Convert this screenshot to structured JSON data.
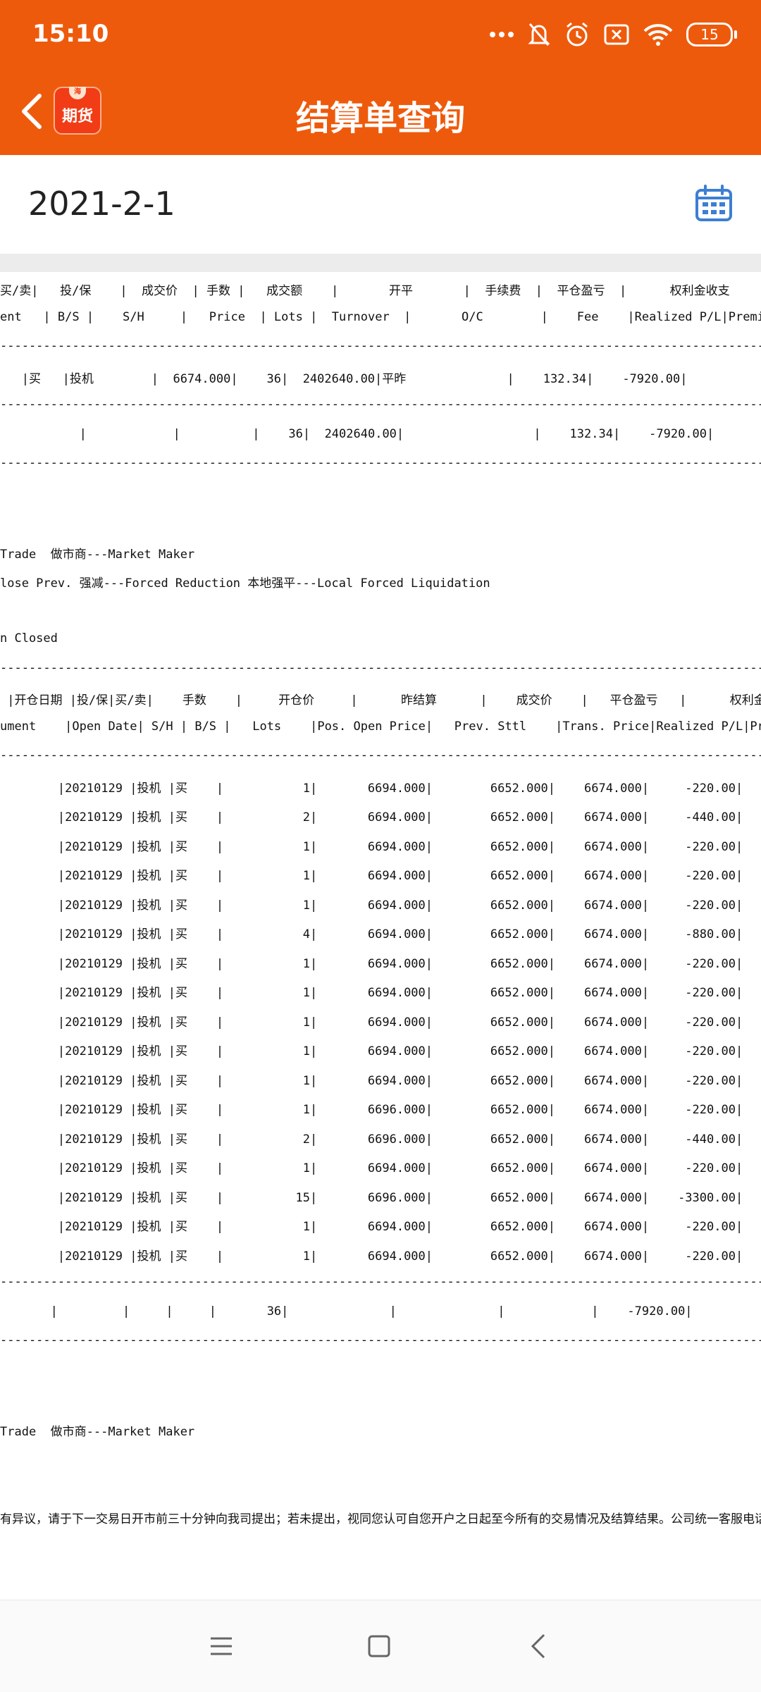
{
  "status_bar": {
    "time": "15:10",
    "battery": "15",
    "icons": [
      "more-dots-icon",
      "mute-bell-icon",
      "alarm-icon",
      "sim-x-icon",
      "wifi-icon",
      "battery-icon"
    ]
  },
  "header": {
    "title": "结算单查询",
    "logo_text": "期货",
    "logo_badge": "海"
  },
  "date": {
    "value": "2021-2-1"
  },
  "statement": {
    "lines": [
      "买/卖|   投/保    |  成交价  | 手数 |   成交额    |       开平       |  手续费  |  平仓盈亏  |      权利金收支       |",
      "ent   | B/S |    S/H     |   Price  | Lots |  Turnover  |       O/C        |    Fee    |Realized P/L|Premium",
      "----------------------------------------------------------------------------------------------------------------",
      "   |买   |投机        |  6674.000|    36|  2402640.00|平昨              |    132.34|    -7920.00|",
      "----------------------------------------------------------------------------------------------------------------",
      "           |            |          |    36|  2402640.00|                  |    132.34|    -7920.00|",
      "----------------------------------------------------------------------------------------------------------------",
      "",
      "",
      "Trade  做市商---Market Maker",
      "lose Prev. 强减---Forced Reduction 本地强平---Local Forced Liquidation",
      "",
      "n Closed",
      "----------------------------------------------------------------------------------------------------------------",
      " |开仓日期 |投/保|买/卖|    手数    |     开仓价     |      昨结算      |    成交价    |   平仓盈亏   |      权利金收支       |",
      "ument    |Open Date| S/H | B/S |   Lots    |Pos. Open Price|   Prev. Sttl    |Trans. Price|Realized P/L|Premium",
      "----------------------------------------------------------------------------------------------------------------"
    ],
    "detail_rows": [
      {
        "date": "20210129",
        "sh": "投机",
        "bs": "买",
        "lots": "1",
        "open": "6694.000",
        "prev": "6652.000",
        "trans": "6674.000",
        "pl": "-220.00"
      },
      {
        "date": "20210129",
        "sh": "投机",
        "bs": "买",
        "lots": "2",
        "open": "6694.000",
        "prev": "6652.000",
        "trans": "6674.000",
        "pl": "-440.00"
      },
      {
        "date": "20210129",
        "sh": "投机",
        "bs": "买",
        "lots": "1",
        "open": "6694.000",
        "prev": "6652.000",
        "trans": "6674.000",
        "pl": "-220.00"
      },
      {
        "date": "20210129",
        "sh": "投机",
        "bs": "买",
        "lots": "1",
        "open": "6694.000",
        "prev": "6652.000",
        "trans": "6674.000",
        "pl": "-220.00"
      },
      {
        "date": "20210129",
        "sh": "投机",
        "bs": "买",
        "lots": "1",
        "open": "6694.000",
        "prev": "6652.000",
        "trans": "6674.000",
        "pl": "-220.00"
      },
      {
        "date": "20210129",
        "sh": "投机",
        "bs": "买",
        "lots": "4",
        "open": "6694.000",
        "prev": "6652.000",
        "trans": "6674.000",
        "pl": "-880.00"
      },
      {
        "date": "20210129",
        "sh": "投机",
        "bs": "买",
        "lots": "1",
        "open": "6694.000",
        "prev": "6652.000",
        "trans": "6674.000",
        "pl": "-220.00"
      },
      {
        "date": "20210129",
        "sh": "投机",
        "bs": "买",
        "lots": "1",
        "open": "6694.000",
        "prev": "6652.000",
        "trans": "6674.000",
        "pl": "-220.00"
      },
      {
        "date": "20210129",
        "sh": "投机",
        "bs": "买",
        "lots": "1",
        "open": "6694.000",
        "prev": "6652.000",
        "trans": "6674.000",
        "pl": "-220.00"
      },
      {
        "date": "20210129",
        "sh": "投机",
        "bs": "买",
        "lots": "1",
        "open": "6694.000",
        "prev": "6652.000",
        "trans": "6674.000",
        "pl": "-220.00"
      },
      {
        "date": "20210129",
        "sh": "投机",
        "bs": "买",
        "lots": "1",
        "open": "6694.000",
        "prev": "6652.000",
        "trans": "6674.000",
        "pl": "-220.00"
      },
      {
        "date": "20210129",
        "sh": "投机",
        "bs": "买",
        "lots": "1",
        "open": "6696.000",
        "prev": "6652.000",
        "trans": "6674.000",
        "pl": "-220.00"
      },
      {
        "date": "20210129",
        "sh": "投机",
        "bs": "买",
        "lots": "2",
        "open": "6696.000",
        "prev": "6652.000",
        "trans": "6674.000",
        "pl": "-440.00"
      },
      {
        "date": "20210129",
        "sh": "投机",
        "bs": "买",
        "lots": "1",
        "open": "6694.000",
        "prev": "6652.000",
        "trans": "6674.000",
        "pl": "-220.00"
      },
      {
        "date": "20210129",
        "sh": "投机",
        "bs": "买",
        "lots": "15",
        "open": "6696.000",
        "prev": "6652.000",
        "trans": "6674.000",
        "pl": "-3300.00"
      },
      {
        "date": "20210129",
        "sh": "投机",
        "bs": "买",
        "lots": "1",
        "open": "6694.000",
        "prev": "6652.000",
        "trans": "6674.000",
        "pl": "-220.00"
      },
      {
        "date": "20210129",
        "sh": "投机",
        "bs": "买",
        "lots": "1",
        "open": "6694.000",
        "prev": "6652.000",
        "trans": "6674.000",
        "pl": "-220.00"
      }
    ],
    "tail_lines": [
      "----------------------------------------------------------------------------------------------------------------",
      "       |         |     |     |       36|              |              |            |    -7920.00|",
      "----------------------------------------------------------------------------------------------------------------",
      "",
      "",
      "Trade  做市商---Market Maker",
      "",
      "",
      "有异议，请于下一交易日开市前三十分钟向我司提出；若未提出，视同您认可自您开户之日起至今所有的交易情况及结算结果。公司统一客服电话"
    ]
  },
  "nav": {
    "icons": [
      "menu-icon",
      "home-icon",
      "back-icon"
    ]
  },
  "colors": {
    "header_bg": "#ee5a0c",
    "calendar_icon": "#3c7fd3"
  }
}
